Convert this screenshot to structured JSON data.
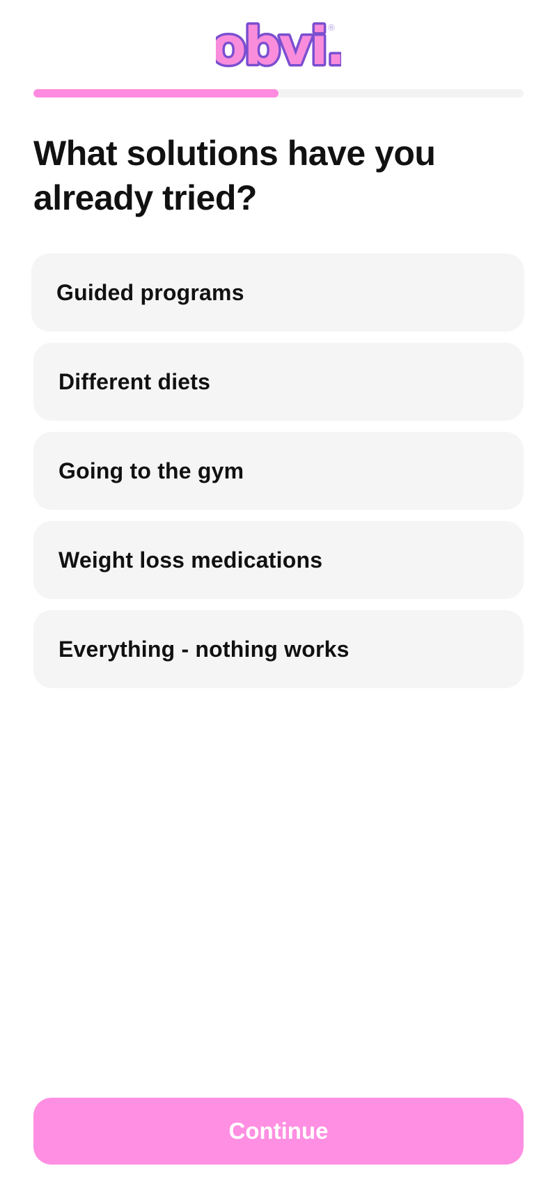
{
  "brand": {
    "logo_text": "obvi.",
    "registered_mark": "®",
    "logo_fill": "#f98ddc",
    "logo_outline": "#7a4fd0"
  },
  "progress": {
    "fraction": 0.5,
    "fill_color": "#ff8be0",
    "track_color": "#f3f3f3"
  },
  "question": {
    "title": "What solutions have you already tried?"
  },
  "options": [
    {
      "label": "Guided programs"
    },
    {
      "label": "Different diets"
    },
    {
      "label": "Going to the gym"
    },
    {
      "label": "Weight loss medications"
    },
    {
      "label": "Everything - nothing works"
    }
  ],
  "footer": {
    "continue_label": "Continue",
    "continue_color": "#ff8fe2"
  }
}
